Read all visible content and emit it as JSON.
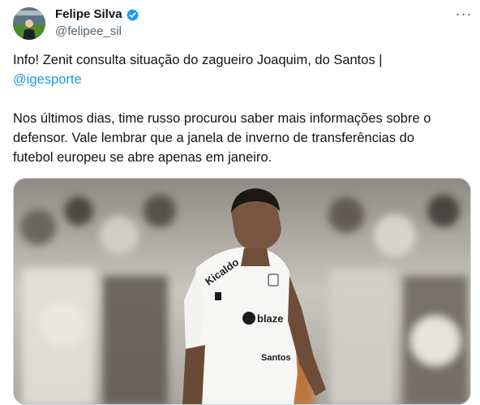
{
  "author": {
    "display_name": "Felipe Silva",
    "handle": "@felipee_sil",
    "verified": true,
    "verified_color": "#1d9bf0"
  },
  "menu": {
    "icon": "more-options-icon",
    "label": "···"
  },
  "tweet": {
    "line1": "Info! Zenit consulta situação do zagueiro Joaquim, do Santos |",
    "mention": "@igesporte",
    "paragraph2_line1": "Nos últimos dias, time russo procurou saber mais informações sobre o",
    "paragraph2_line2": "defensor. Vale lembrar que a janela de inverno de transferências do",
    "paragraph2_line3": "futebol europeu se abre apenas em janeiro."
  },
  "media": {
    "description_icon": "photo-player-icon",
    "sponsor_text": "Kicaldo",
    "chest_text": "blaze",
    "brand_text": "Santos"
  },
  "colors": {
    "text": "#0f1419",
    "secondary": "#536471",
    "link": "#1d9bf0"
  }
}
